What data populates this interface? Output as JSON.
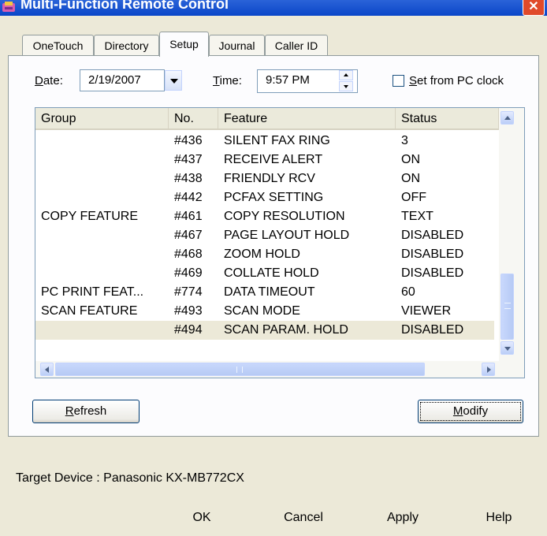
{
  "window": {
    "title": "Multi-Function Remote Control",
    "close_glyph": "✕"
  },
  "tabs": [
    {
      "label": "OneTouch"
    },
    {
      "label": "Directory"
    },
    {
      "label": "Setup",
      "active": true
    },
    {
      "label": "Journal"
    },
    {
      "label": "Caller ID"
    }
  ],
  "setup": {
    "date_label_key": "D",
    "date_label_rest": "ate:",
    "date_value": "2/19/2007",
    "time_label_key": "T",
    "time_label_rest": "ime:",
    "time_value": "9:57 PM",
    "pc_clock_label_key": "S",
    "pc_clock_label_rest": "et from PC clock",
    "pc_clock_checked": false
  },
  "list": {
    "columns": [
      "Group",
      "No.",
      "Feature",
      "Status"
    ],
    "rows": [
      {
        "group": "",
        "no": "#436",
        "feature": "SILENT FAX RING",
        "status": "3"
      },
      {
        "group": "",
        "no": "#437",
        "feature": "RECEIVE ALERT",
        "status": "ON"
      },
      {
        "group": "",
        "no": "#438",
        "feature": "FRIENDLY RCV",
        "status": "ON"
      },
      {
        "group": "",
        "no": "#442",
        "feature": "PCFAX SETTING",
        "status": "OFF"
      },
      {
        "group": "COPY FEATURE",
        "no": "#461",
        "feature": "COPY RESOLUTION",
        "status": "TEXT"
      },
      {
        "group": "",
        "no": "#467",
        "feature": "PAGE LAYOUT HOLD",
        "status": "DISABLED"
      },
      {
        "group": "",
        "no": "#468",
        "feature": "ZOOM HOLD",
        "status": "DISABLED"
      },
      {
        "group": "",
        "no": "#469",
        "feature": "COLLATE HOLD",
        "status": "DISABLED"
      },
      {
        "group": "PC PRINT FEAT...",
        "no": "#774",
        "feature": "DATA TIMEOUT",
        "status": "60"
      },
      {
        "group": "SCAN FEATURE",
        "no": "#493",
        "feature": "SCAN MODE",
        "status": "VIEWER"
      },
      {
        "group": "",
        "no": "#494",
        "feature": "SCAN PARAM. HOLD",
        "status": "DISABLED",
        "selected": true
      }
    ]
  },
  "buttons": {
    "refresh_key": "R",
    "refresh_rest": "efresh",
    "modify_key": "M",
    "modify_rest": "odify",
    "ok": "OK",
    "cancel": "Cancel",
    "apply": "Apply",
    "help": "Help"
  },
  "status": {
    "target_device": "Target Device : Panasonic KX-MB772CX"
  },
  "colors": {
    "titlebar": "#0A46C8",
    "dialog_bg": "#ECE9D8",
    "selected_row": "#ECE9D8",
    "scroll_accent": "#C3D3FD"
  }
}
